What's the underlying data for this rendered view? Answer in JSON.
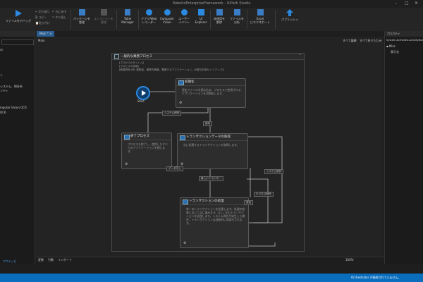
{
  "window": {
    "title": "RoboticEnterpriseFramework - UiPath Studio"
  },
  "ribbon": {
    "run_label": "ファイルをデバッグ",
    "small_left": [
      "切り取り",
      "コピー",
      "貼り付け"
    ],
    "small_right": [
      "元に戻す",
      "やり直し"
    ],
    "buttons": [
      {
        "label": "パッケージを\n管理"
      },
      {
        "label": "エンティティを\n管理"
      },
      {
        "label": "Table\nManager"
      },
      {
        "label": "アプリ/Web\nレコーダー"
      },
      {
        "label": "Computer\nVision"
      },
      {
        "label": "ユーザー\nイベント"
      },
      {
        "label": "UI\nExplorer"
      },
      {
        "label": "未使用を\n削除"
      },
      {
        "label": "ファイルを\n分析"
      },
      {
        "label": "Excel\nにエクスポート"
      },
      {
        "label": "パブリッシュ"
      }
    ]
  },
  "tabs": {
    "main": "Main *"
  },
  "breadcrumb": "Main",
  "designer_toolbar": {
    "expand_all": "すべて展開",
    "collapse_all": "すべて折りたたみ"
  },
  "left_panel": {
    "items": [
      "の",
      "ト",
      "システム、例外系",
      "ンティ",
      "mputer Vision OCR",
      "OCR"
    ],
    "bottom": "アクティビ"
  },
  "properties": {
    "header": "プロパティ",
    "type": "System.Activities.ActivityBuilder",
    "section": "Misc",
    "field": "表示名"
  },
  "flowchart": {
    "title": "一般的な業務プロセス",
    "desc": [
      "[プロセスのタイトル]",
      "[プロセスの説明]",
      "[概要説明 (例: 業務量、連携先情報、関連するアプリケーション、必要な外部セットアップ)]"
    ],
    "start_label": "Start",
    "nodes": {
      "init": {
        "title": "初期化",
        "body": "設定ファイルを読み込み、プロセスで使用されるアプリケーションを初期化します。"
      },
      "end": {
        "title": "終了プロセス",
        "body": "プロセスを終了し、使用したすべてのアプリケーションを閉じます。"
      },
      "get": {
        "title": "トランザクションデータの取得",
        "body": "次に処理するトランザクションを取得します。"
      },
      "process": {
        "title": "トランザクションの処理",
        "body": "単一のトランザクションを処理します。処理の結果に応じて次に進みます。なし: 次のトランザクションを処理します。システム例外が発生した場合、トランザクションは自動的に再試行されます。"
      }
    },
    "edge_labels": [
      "システム例外",
      "成功",
      "データなし",
      "新しいトランザ...",
      "システム例外",
      "ビジネス例外",
      "成功"
    ]
  },
  "bottom_tabs": [
    "変数",
    "引数",
    "インポート"
  ],
  "zoom": "100%",
  "status": {
    "orchestrator": "Orchestrator が接続されていません。"
  }
}
